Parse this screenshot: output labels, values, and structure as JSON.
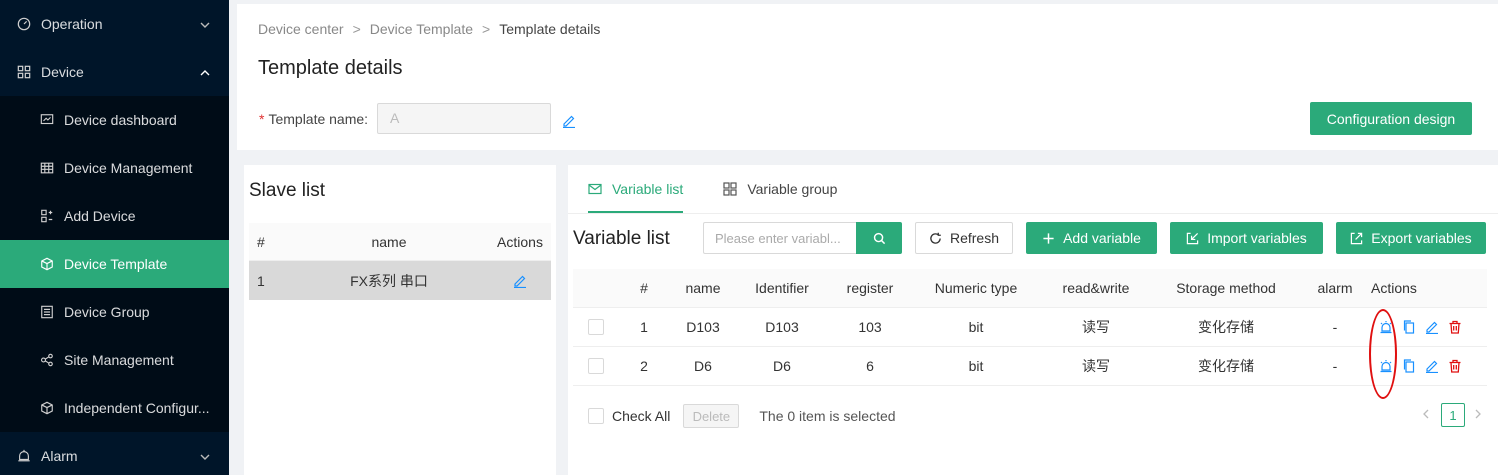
{
  "sidebar": {
    "items": [
      {
        "label": "Operation",
        "icon": "dashboard-gauge-icon",
        "level": "top",
        "expanded": false
      },
      {
        "label": "Device",
        "icon": "grid-icon",
        "level": "top",
        "expanded": true
      },
      {
        "label": "Device dashboard",
        "icon": "monitor-chart-icon",
        "level": "sub"
      },
      {
        "label": "Device Management",
        "icon": "table-icon",
        "level": "sub"
      },
      {
        "label": "Add Device",
        "icon": "add-device-icon",
        "level": "sub"
      },
      {
        "label": "Device Template",
        "icon": "cube-icon",
        "level": "sub",
        "active": true
      },
      {
        "label": "Device Group",
        "icon": "group-icon",
        "level": "sub"
      },
      {
        "label": "Site Management",
        "icon": "site-nodes-icon",
        "level": "sub"
      },
      {
        "label": "Independent Configur...",
        "icon": "box-icon",
        "level": "sub"
      },
      {
        "label": "Alarm",
        "icon": "alarm-bell-icon",
        "level": "top",
        "expanded": false
      }
    ]
  },
  "breadcrumb": {
    "items": [
      "Device center",
      "Device Template",
      "Template details"
    ],
    "separator": ">"
  },
  "header": {
    "title": "Template details",
    "template_name_label": "Template name",
    "template_name_colon": ":",
    "required_mark": "*",
    "template_name_value": "A",
    "config_button": "Configuration design"
  },
  "slave": {
    "title": "Slave list",
    "columns": [
      "#",
      "name",
      "Actions"
    ],
    "rows": [
      {
        "index": "1",
        "name": "FX系列 串口"
      }
    ]
  },
  "variables": {
    "tabs": [
      {
        "label": "Variable list",
        "icon": "mail-icon",
        "active": true
      },
      {
        "label": "Variable group",
        "icon": "grid-icon",
        "active": false
      }
    ],
    "title": "Variable list",
    "search_placeholder": "Please enter variabl...",
    "refresh_label": "Refresh",
    "add_label": "Add variable",
    "import_label": "Import variables",
    "export_label": "Export variables",
    "columns": [
      "#",
      "name",
      "Identifier",
      "register",
      "Numeric type",
      "read&write",
      "Storage method",
      "alarm",
      "Actions"
    ],
    "rows": [
      {
        "index": "1",
        "name": "D103",
        "identifier": "D103",
        "register": "103",
        "type": "bit",
        "rw": "读写",
        "storage": "变化存储",
        "alarm": "-"
      },
      {
        "index": "2",
        "name": "D6",
        "identifier": "D6",
        "register": "6",
        "type": "bit",
        "rw": "读写",
        "storage": "变化存储",
        "alarm": "-"
      }
    ],
    "check_all_label": "Check All",
    "delete_label": "Delete",
    "selected_text": "The 0 item is selected",
    "current_page": "1"
  },
  "colors": {
    "accent": "#2baa7a",
    "sidebar_bg": "#001529",
    "danger": "#e01010",
    "link": "#1890ff"
  }
}
